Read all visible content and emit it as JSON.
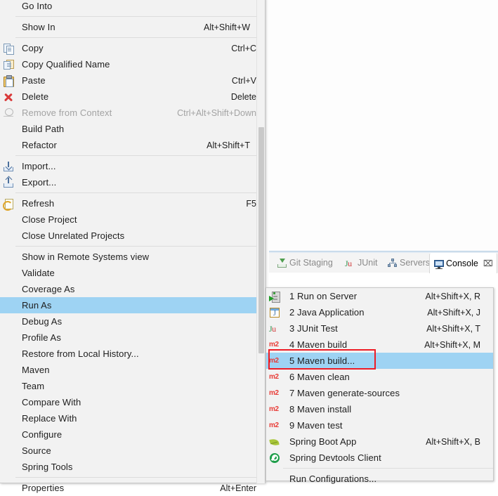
{
  "theme": {
    "menu_bg": "#f2f2f2",
    "menu_border": "#c8c8c8",
    "highlight": "#9ed3f3",
    "annotation_red": "#ee1c25",
    "text": "#1d1d1d",
    "disabled_text": "#a3a3a3"
  },
  "tabs": [
    {
      "label": "Git Staging",
      "icon": "git-staging-icon",
      "active": false,
      "closable": false
    },
    {
      "label": "JUnit",
      "icon": "junit-icon",
      "active": false,
      "closable": false
    },
    {
      "label": "Servers",
      "icon": "servers-icon",
      "active": false,
      "closable": false
    },
    {
      "label": "Console",
      "icon": "console-icon",
      "active": true,
      "closable": true,
      "close_glyph": "⌧"
    }
  ],
  "context_menu": {
    "name": "project-context-menu",
    "groups": [
      {
        "items": [
          {
            "label": "Go Into",
            "icon": null,
            "accel": "",
            "arrow": false,
            "disabled": false
          }
        ]
      },
      {
        "items": [
          {
            "label": "Show In",
            "icon": null,
            "accel": "Alt+Shift+W",
            "arrow": true,
            "disabled": false
          }
        ]
      },
      {
        "items": [
          {
            "label": "Copy",
            "icon": "copy-icon",
            "accel": "Ctrl+C",
            "arrow": false,
            "disabled": false
          },
          {
            "label": "Copy Qualified Name",
            "icon": "copy-qualified-name-icon",
            "accel": "",
            "arrow": false,
            "disabled": false
          },
          {
            "label": "Paste",
            "icon": "paste-icon",
            "accel": "Ctrl+V",
            "arrow": false,
            "disabled": false
          },
          {
            "label": "Delete",
            "icon": "delete-icon",
            "accel": "Delete",
            "arrow": false,
            "disabled": false
          },
          {
            "label": "Remove from Context",
            "icon": "remove-from-context-icon",
            "accel": "Ctrl+Alt+Shift+Down",
            "arrow": false,
            "disabled": true
          },
          {
            "label": "Build Path",
            "icon": null,
            "accel": "",
            "arrow": true,
            "disabled": false
          },
          {
            "label": "Refactor",
            "icon": null,
            "accel": "Alt+Shift+T",
            "arrow": true,
            "disabled": false
          }
        ]
      },
      {
        "items": [
          {
            "label": "Import...",
            "icon": "import-icon",
            "accel": "",
            "arrow": false,
            "disabled": false
          },
          {
            "label": "Export...",
            "icon": "export-icon",
            "accel": "",
            "arrow": false,
            "disabled": false
          }
        ]
      },
      {
        "items": [
          {
            "label": "Refresh",
            "icon": "refresh-icon",
            "accel": "F5",
            "arrow": false,
            "disabled": false
          },
          {
            "label": "Close Project",
            "icon": null,
            "accel": "",
            "arrow": false,
            "disabled": false
          },
          {
            "label": "Close Unrelated Projects",
            "icon": null,
            "accel": "",
            "arrow": false,
            "disabled": false
          }
        ]
      },
      {
        "items": [
          {
            "label": "Show in Remote Systems view",
            "icon": null,
            "accel": "",
            "arrow": false,
            "disabled": false
          },
          {
            "label": "Validate",
            "icon": null,
            "accel": "",
            "arrow": false,
            "disabled": false
          },
          {
            "label": "Coverage As",
            "icon": null,
            "accel": "",
            "arrow": true,
            "disabled": false
          },
          {
            "label": "Run As",
            "icon": null,
            "accel": "",
            "arrow": true,
            "disabled": false,
            "selected": true
          },
          {
            "label": "Debug As",
            "icon": null,
            "accel": "",
            "arrow": true,
            "disabled": false
          },
          {
            "label": "Profile As",
            "icon": null,
            "accel": "",
            "arrow": true,
            "disabled": false
          },
          {
            "label": "Restore from Local History...",
            "icon": null,
            "accel": "",
            "arrow": false,
            "disabled": false
          },
          {
            "label": "Maven",
            "icon": null,
            "accel": "",
            "arrow": true,
            "disabled": false
          },
          {
            "label": "Team",
            "icon": null,
            "accel": "",
            "arrow": true,
            "disabled": false
          },
          {
            "label": "Compare With",
            "icon": null,
            "accel": "",
            "arrow": true,
            "disabled": false
          },
          {
            "label": "Replace With",
            "icon": null,
            "accel": "",
            "arrow": true,
            "disabled": false
          },
          {
            "label": "Configure",
            "icon": null,
            "accel": "",
            "arrow": true,
            "disabled": false
          },
          {
            "label": "Source",
            "icon": null,
            "accel": "",
            "arrow": true,
            "disabled": false
          },
          {
            "label": "Spring Tools",
            "icon": null,
            "accel": "",
            "arrow": true,
            "disabled": false
          }
        ]
      },
      {
        "items": [
          {
            "label": "Properties",
            "icon": null,
            "accel": "Alt+Enter",
            "arrow": false,
            "disabled": false
          }
        ]
      }
    ]
  },
  "run_as_submenu": {
    "name": "run-as-submenu",
    "groups": [
      {
        "items": [
          {
            "label": "1 Run on Server",
            "icon": "run-on-server-icon",
            "accel": "Alt+Shift+X, R",
            "highlighted": false
          },
          {
            "label": "2 Java Application",
            "icon": "java-application-icon",
            "accel": "Alt+Shift+X, J",
            "highlighted": false
          },
          {
            "label": "3 JUnit Test",
            "icon": "junit-icon",
            "accel": "Alt+Shift+X, T",
            "highlighted": false
          },
          {
            "label": "4 Maven build",
            "icon": "maven-icon",
            "accel": "Alt+Shift+X, M",
            "highlighted": false
          },
          {
            "label": "5 Maven build...",
            "icon": "maven-icon",
            "accel": "",
            "highlighted": true,
            "annotated": true
          },
          {
            "label": "6 Maven clean",
            "icon": "maven-icon",
            "accel": "",
            "highlighted": false
          },
          {
            "label": "7 Maven generate-sources",
            "icon": "maven-icon",
            "accel": "",
            "highlighted": false
          },
          {
            "label": "8 Maven install",
            "icon": "maven-icon",
            "accel": "",
            "highlighted": false
          },
          {
            "label": "9 Maven test",
            "icon": "maven-icon",
            "accel": "",
            "highlighted": false
          },
          {
            "label": "Spring Boot App",
            "icon": "spring-boot-icon",
            "accel": "Alt+Shift+X, B",
            "highlighted": false
          },
          {
            "label": "Spring Devtools Client",
            "icon": "spring-devtools-icon",
            "accel": "",
            "highlighted": false
          }
        ]
      },
      {
        "items": [
          {
            "label": "Run Configurations...",
            "icon": null,
            "accel": "",
            "highlighted": false
          }
        ]
      }
    ]
  }
}
